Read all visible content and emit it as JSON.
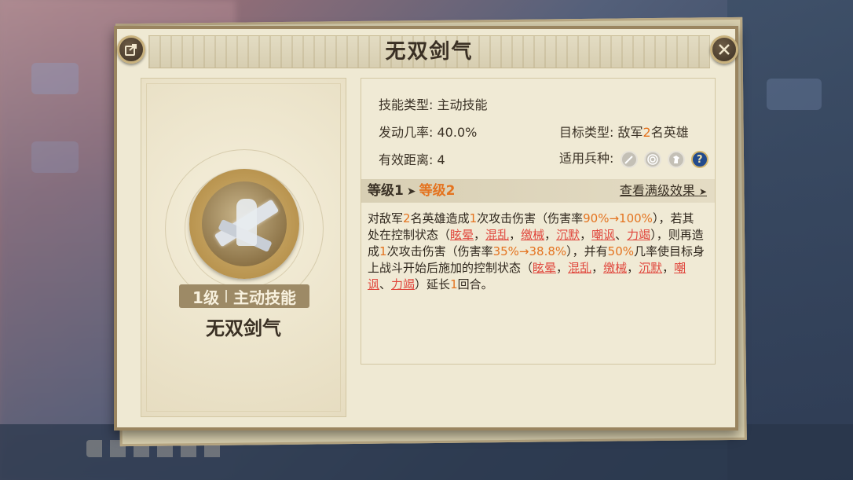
{
  "dialog": {
    "title": "无双剑气",
    "share_icon": "share-icon",
    "close_icon": "close-icon"
  },
  "skill": {
    "icon": "sword-qi-skill-icon",
    "level_label": "1级",
    "type_label": "主动技能",
    "name": "无双剑气"
  },
  "info": {
    "skill_type_label": "技能类型:",
    "skill_type_value": "主动技能",
    "trigger_rate_label": "发动几率:",
    "trigger_rate_value": "40.0%",
    "range_label": "有效距离:",
    "range_value": "4",
    "target_label": "目标类型:",
    "target_prefix": "敌军",
    "target_count": "2",
    "target_suffix": "名英雄",
    "troop_label": "适用兵种:",
    "troop_icons": [
      "sword-icon",
      "bow-target-icon",
      "cavalry-horse-icon",
      "help-icon"
    ],
    "help_glyph": "?"
  },
  "level": {
    "current": "等级1",
    "arrow": "➤",
    "next": "等级2",
    "view_max": "查看满级效果",
    "view_max_arrow": "➤"
  },
  "description": {
    "p1": "对敌军",
    "n1": "2",
    "p2": "名英雄造成",
    "n2": "1",
    "p3": "次攻击伤害（伤害率",
    "n3": "90%→100%",
    "p4": "），若其处在控制状态（",
    "s1": "眩晕",
    "c1": "，",
    "s2": "混乱",
    "c2": "，",
    "s3": "缴械",
    "c3": "，",
    "s4": "沉默",
    "c4": "，",
    "s5": "嘲讽",
    "c5": "、",
    "s6": "力竭",
    "p5": "），则再造成",
    "n4": "1",
    "p6": "次攻击伤害（伤害率",
    "n5": "35%→38.8%",
    "p7": "），并有",
    "n6": "50%",
    "p8": "几率使目标身上战斗开始后施加的控制状态（",
    "t1": "眩晕",
    "d1": "，",
    "t2": "混乱",
    "d2": "，",
    "t3": "缴械",
    "d3": "，",
    "t4": "沉默",
    "d4": "，",
    "t5": "嘲讽",
    "d5": "、",
    "t6": "力竭",
    "p9": "）延长",
    "n7": "1",
    "p10": "回合。"
  },
  "colors": {
    "highlight_orange": "#e4731f",
    "status_red": "#e0463c",
    "panel_bg": "#efe9d3",
    "frame": "#9a8560"
  }
}
